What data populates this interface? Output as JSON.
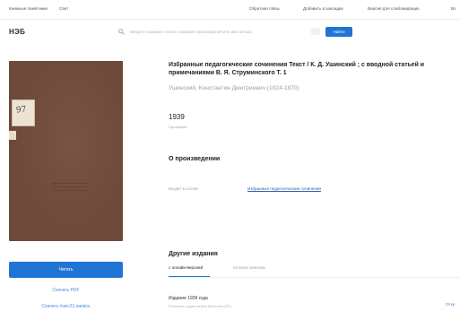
{
  "topbar": {
    "left_links": [
      "Книжные памятники",
      "Свет"
    ],
    "right_links": [
      "Обратная связь",
      "Добавить в закладки",
      "Версия для слабовидящих",
      "Вх"
    ]
  },
  "header": {
    "logo": "НЭБ",
    "search": {
      "placeholder": "Введите название статьи, название произведения или имя автора",
      "button_label": "Найти"
    }
  },
  "book": {
    "cover_mark": "97",
    "read_button": "Читать",
    "download_pdf": "Скачать PDF",
    "download_marc": "Скачать marc21-запись",
    "title": "Избранные педагогические сочинения Текст / К. Д. Ушинский ; с вводной статьей и примечаниями В. Я. Струминского Т. 1",
    "author": "Ушинский, Константин Дмитриевич (1824-1870)",
    "year": "1939",
    "year_caption": "Год издания"
  },
  "about": {
    "heading": "О произведении",
    "label": "Входит в состав",
    "link": "Избранные педагогические сочинения"
  },
  "other_editions": {
    "heading": "Другие издания",
    "tabs": [
      "с онлайн-версией",
      "по всем записям"
    ],
    "items": [
      {
        "title": "Издание 1939 года",
        "subtitle": "Российская государственная библиотека (РГБ)",
        "action": "Откр"
      }
    ]
  }
}
